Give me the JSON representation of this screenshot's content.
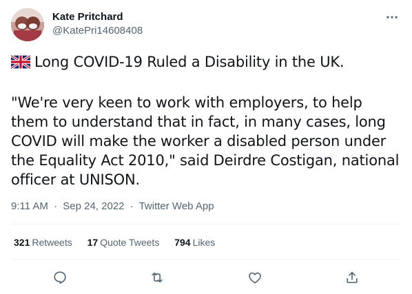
{
  "author": {
    "display_name": "Kate Pritchard",
    "handle": "@KatePri14608408",
    "avatar_icon": "avatar-photo"
  },
  "tweet": {
    "flag_icon": "uk-flag-icon",
    "headline": "Long COVID-19 Ruled a Disability in the UK.",
    "body": "\"We're very keen to work with employers, to help them to understand that in fact, in many cases, long COVID will make the worker a disabled person under the Equality Act 2010,\" said Deirdre Costigan, national officer at UNISON."
  },
  "meta": {
    "time": "9:11 AM",
    "date": "Sep 24, 2022",
    "source": "Twitter Web App",
    "separator": "·"
  },
  "stats": {
    "retweets": {
      "count": "321",
      "label": "Retweets"
    },
    "quotes": {
      "count": "17",
      "label": "Quote Tweets"
    },
    "likes": {
      "count": "794",
      "label": "Likes"
    }
  },
  "actions": [
    "reply-icon",
    "retweet-icon",
    "like-icon",
    "share-icon"
  ],
  "colors": {
    "text": "#0f1419",
    "secondary": "#536471",
    "divider": "#eff3f4"
  }
}
